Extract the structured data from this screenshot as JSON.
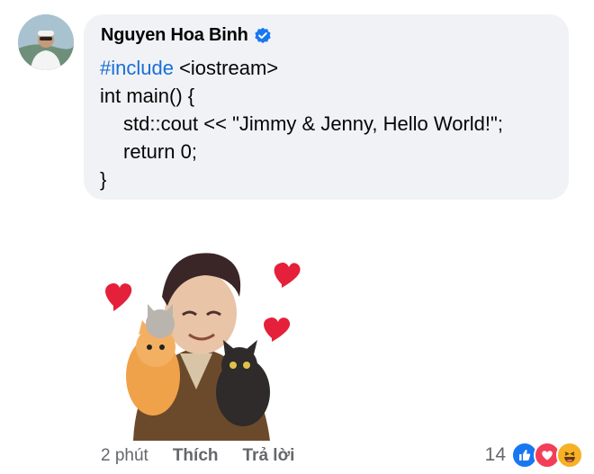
{
  "comment": {
    "author": "Nguyen Hoa Binh",
    "verified": true,
    "code_lines": [
      {
        "tag": "#include",
        "rest": " <iostream>"
      },
      {
        "text": "int main() {"
      },
      {
        "text": "std::cout << \"Jimmy & Jenny, Hello World!\";"
      },
      {
        "text": "return 0;"
      },
      {
        "text": "}"
      }
    ]
  },
  "sticker": {
    "icon": "avatar-sticker-with-cats-and-hearts"
  },
  "actions": {
    "time": "2 phút",
    "like_label": "Thích",
    "reply_label": "Trả lời"
  },
  "reactions": {
    "count": "14",
    "types": [
      "like",
      "love",
      "haha"
    ]
  },
  "colors": {
    "bubble": "#f0f2f5",
    "link": "#1a6fd6",
    "muted": "#65676b",
    "verified": "#1877f2"
  }
}
